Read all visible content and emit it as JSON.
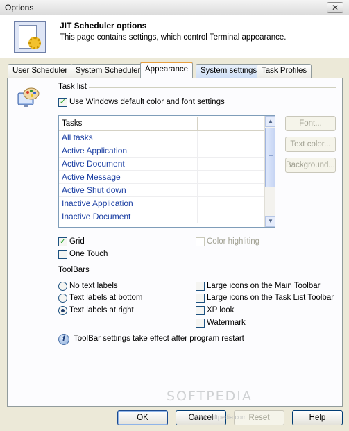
{
  "window": {
    "title": "Options",
    "close_glyph": "✕"
  },
  "header": {
    "title": "JIT Scheduler options",
    "subtitle": "This page contains settings, which control Terminal appearance.",
    "icon": "scheduler-options-icon"
  },
  "tabs": [
    {
      "label": "User Scheduler"
    },
    {
      "label": "System Scheduler"
    },
    {
      "label": "Appearance"
    },
    {
      "label": "System settings"
    },
    {
      "label": "Task Profiles"
    }
  ],
  "task_list": {
    "group_label": "Task list",
    "use_windows_default": {
      "label": "Use Windows default color and font settings",
      "checked": true
    },
    "column_header": "Tasks",
    "rows": [
      "All tasks",
      "Active Application",
      "Active Document",
      "Active Message",
      "Active Shut down",
      "Inactive Application",
      "Inactive Document"
    ],
    "buttons": {
      "font": "Font...",
      "text_color": "Text color...",
      "background": "Background..."
    },
    "grid": {
      "label": "Grid",
      "checked": true
    },
    "one_touch": {
      "label": "One Touch",
      "checked": false
    },
    "color_highlighting": {
      "label": "Color highliting",
      "checked": false
    }
  },
  "toolbars": {
    "group_label": "ToolBars",
    "radios": [
      {
        "label": "No text labels",
        "selected": false
      },
      {
        "label": "Text labels at bottom",
        "selected": false
      },
      {
        "label": "Text labels at right",
        "selected": true
      }
    ],
    "checks": [
      {
        "label": "Large icons on the Main Toolbar",
        "checked": false
      },
      {
        "label": "Large icons on the Task List Toolbar",
        "checked": false
      },
      {
        "label": "XP look",
        "checked": false
      },
      {
        "label": "Watermark",
        "checked": false
      }
    ],
    "info": "ToolBar settings take effect after program restart"
  },
  "buttons": {
    "ok": "OK",
    "cancel": "Cancel",
    "reset": "Reset",
    "help": "Help"
  },
  "watermark": {
    "text": "SOFTPEDIA",
    "url": "www.softpedia.com"
  },
  "colors": {
    "accent_tab": "#e8a040",
    "link_text": "#1b3fa3",
    "check_mark": "#21a121"
  }
}
